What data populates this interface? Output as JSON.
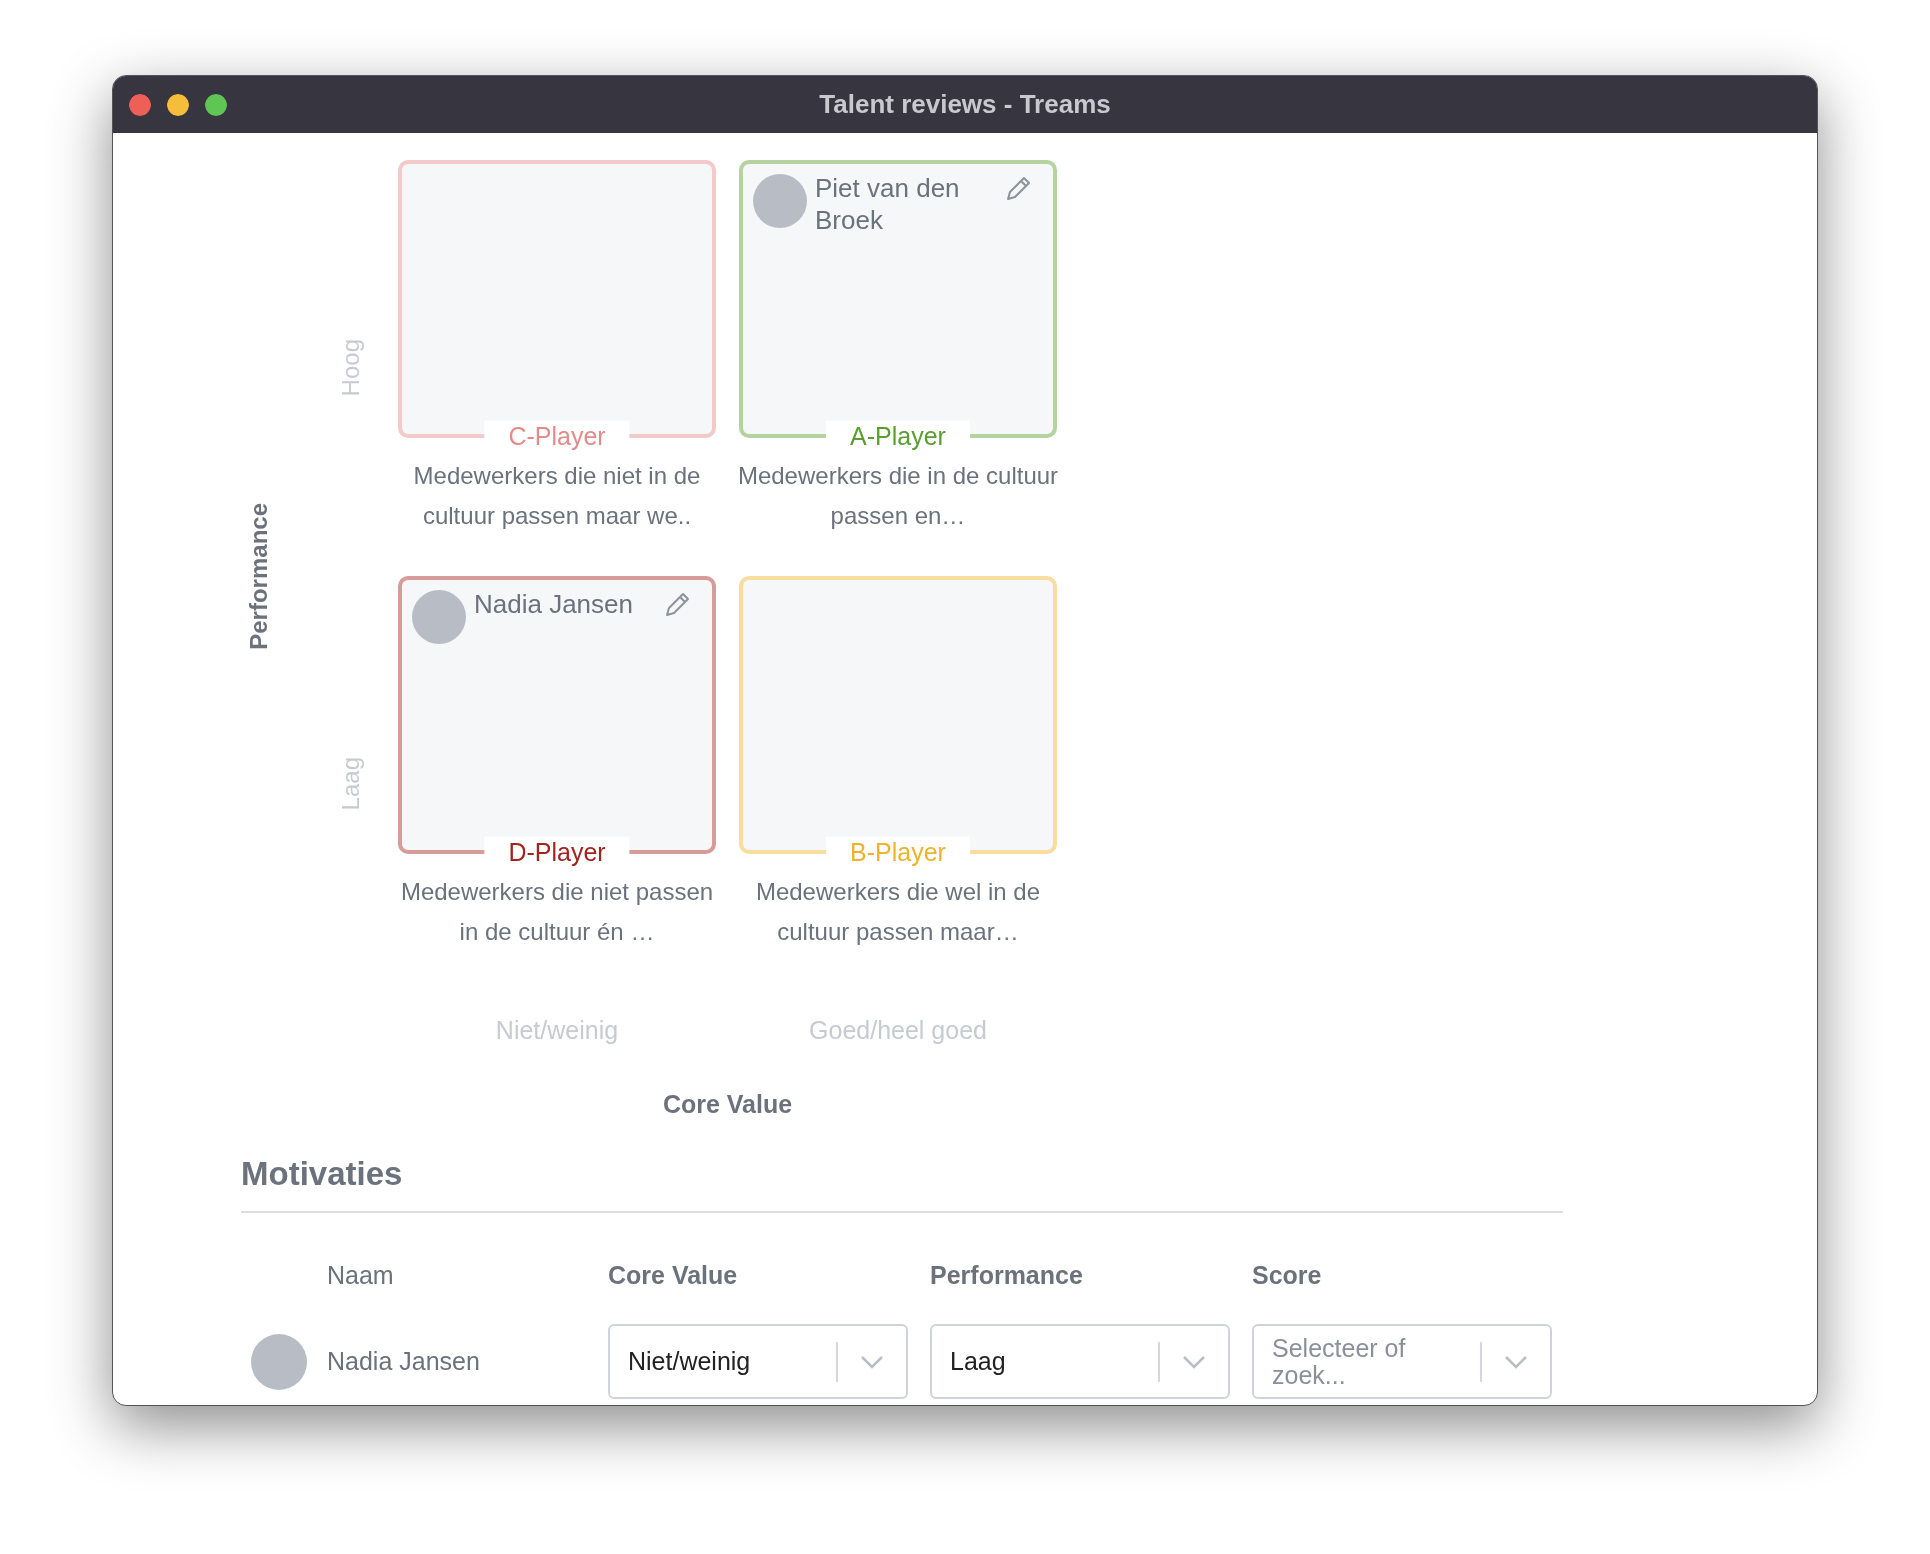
{
  "window": {
    "title": "Talent reviews - Treams"
  },
  "matrix": {
    "y_axis": {
      "title": "Performance",
      "levels": [
        "Hoog",
        "Laag"
      ]
    },
    "x_axis": {
      "title": "Core Value",
      "levels": [
        "Niet/weinig",
        "Goed/heel goed"
      ]
    },
    "quadrants": [
      {
        "label": "C-Player",
        "color": "#e58a8a",
        "description": "Medewerkers die niet in de cultuur passen maar we.."
      },
      {
        "label": "A-Player",
        "color": "#5a9e2f",
        "description": "Medewerkers die in de cultuur passen en…",
        "people": [
          {
            "name": "Piet van den Broek"
          }
        ]
      },
      {
        "label": "D-Player",
        "color": "#a3231f",
        "description": "Medewerkers die niet passen in de cultuur én …",
        "people": [
          {
            "name": "Nadia Jansen"
          }
        ]
      },
      {
        "label": "B-Player",
        "color": "#efb22b",
        "description": "Medewerkers die wel in de cultuur passen maar…"
      }
    ]
  },
  "motivations": {
    "title": "Motivaties",
    "columns": [
      {
        "label": "Naam",
        "kind": "name"
      },
      {
        "label": "Core Value",
        "kind": "select"
      },
      {
        "label": "Performance",
        "kind": "select"
      },
      {
        "label": "Score",
        "kind": "select"
      }
    ],
    "rows": [
      {
        "name": "Nadia Jansen",
        "fields": [
          {
            "value": "Niet/weinig"
          },
          {
            "value": "Laag"
          },
          {
            "placeholder": "Selecteer of zoek..."
          }
        ]
      }
    ]
  }
}
